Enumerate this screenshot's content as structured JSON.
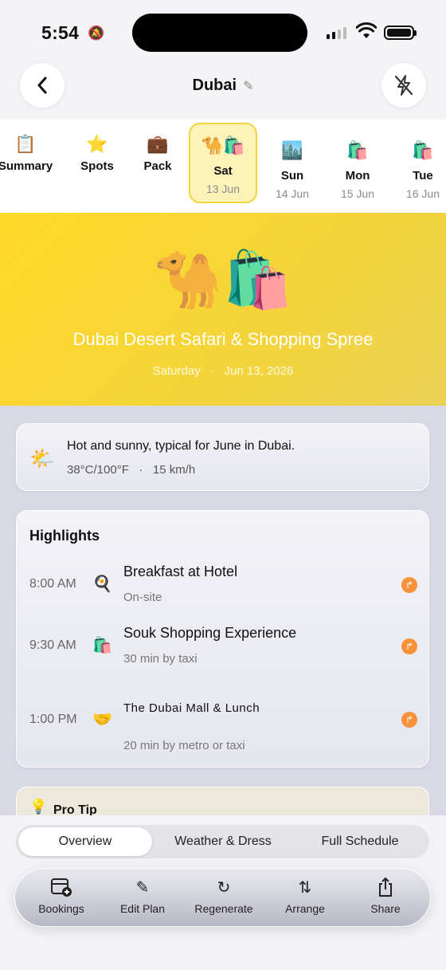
{
  "status": {
    "time": "5:54"
  },
  "header": {
    "title": "Dubai"
  },
  "days": [
    {
      "emoji": "📋",
      "label": "Summary"
    },
    {
      "emoji": "⭐",
      "label": "Spots"
    },
    {
      "emoji": "💼",
      "label": "Pack"
    },
    {
      "emoji": "🐪🛍️",
      "label": "Sat",
      "date": "13 Jun"
    },
    {
      "emoji": "🏙️",
      "label": "Sun",
      "date": "14 Jun"
    },
    {
      "emoji": "🛍️",
      "label": "Mon",
      "date": "15 Jun"
    },
    {
      "emoji": "🛍️",
      "label": "Tue",
      "date": "16 Jun"
    }
  ],
  "hero": {
    "emoji": "🐪🛍️",
    "title": "Dubai Desert Safari & Shopping Spree",
    "weekday": "Saturday",
    "date": "Jun 13, 2026"
  },
  "weather": {
    "summary": "Hot and sunny, typical for June in Dubai.",
    "temp": "38°C/100°F",
    "wind": "15 km/h"
  },
  "highlights": {
    "heading": "Highlights",
    "items": [
      {
        "time": "8:00 AM",
        "icon": "🍳",
        "name": "Breakfast at Hotel",
        "sub": "On-site"
      },
      {
        "time": "9:30 AM",
        "icon": "🛍️",
        "name": "Souk Shopping Experience",
        "sub": "30 min by taxi"
      },
      {
        "time": "1:00 PM",
        "icon": "🤝",
        "name": "The Dubai Mall & Lunch",
        "sub": "20 min by metro or taxi"
      }
    ]
  },
  "tip": {
    "label": "Pro Tip"
  },
  "tabs": [
    "Overview",
    "Weather & Dress",
    "Full Schedule"
  ],
  "toolbar": [
    "Bookings",
    "Edit Plan",
    "Regenerate",
    "Arrange",
    "Share"
  ],
  "colors": {
    "accent": "#f7913a",
    "hero": "#ffd92a",
    "selected_day": "#fdf2b8"
  }
}
